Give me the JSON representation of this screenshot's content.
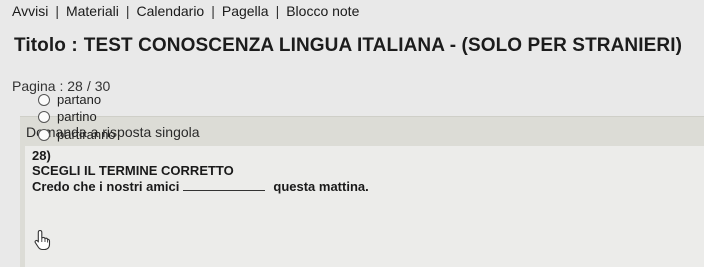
{
  "nav": {
    "items": [
      "Avvisi",
      "Materiali",
      "Calendario",
      "Pagella",
      "Blocco note"
    ],
    "separator": "|"
  },
  "title": {
    "prefix": "Titolo :",
    "text": "TEST CONOSCENZA LINGUA ITALIANA - (SOLO PER STRANIERI)"
  },
  "pager": {
    "label": "Pagina :",
    "current": "28",
    "separator": "/",
    "total": "30"
  },
  "question": {
    "type_label": "Domanda a risposta singola",
    "number": "28)",
    "instruction": "SCEGLI IL TERMINE CORRETTO",
    "sentence_before": "Credo che i nostri amici",
    "sentence_after": "questa mattina.",
    "options": [
      "partano",
      "partino",
      "partiranno"
    ]
  },
  "colors": {
    "background": "#e9e9e9",
    "question_panel": "#dcdcd6",
    "question_inner": "#ececea"
  }
}
